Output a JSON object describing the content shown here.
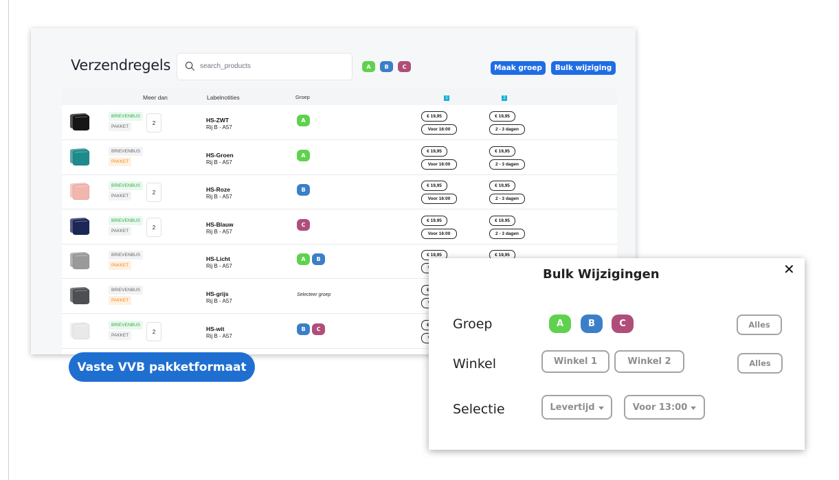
{
  "page": {
    "title": "Verzendregels"
  },
  "search": {
    "placeholder": "search_products"
  },
  "header_groups": [
    "A",
    "B",
    "C"
  ],
  "buttons": {
    "maak_groep": "Maak groep",
    "bulk_wijziging": "Bulk wijziging",
    "cta": "Vaste VVB pakketformaat"
  },
  "table": {
    "columns": {
      "meer_dan": "Meer dan",
      "labelnotities": "Labelnotities",
      "groep": "Groep",
      "shop1": "1",
      "shop2": "2"
    },
    "tag_labels": {
      "brievenbus": "BRIEVENBUS",
      "pakket": "PAKKET"
    },
    "rows": [
      {
        "name": "HS-ZWT",
        "location": "Rij B - A57",
        "active": "brievenbus",
        "qty": "2",
        "groups": [
          "A"
        ],
        "price1": "€ 19,95",
        "time1": "Voor 16:00",
        "price2": "€ 19,95",
        "time2": "2 - 3 dagen",
        "color": "#151515"
      },
      {
        "name": "HS-Groen",
        "location": "Rij B - A57",
        "active": "pakket",
        "qty": "",
        "groups": [
          "A"
        ],
        "price1": "€ 19,95",
        "time1": "Voor 16:00",
        "price2": "€ 19,95",
        "time2": "2 - 3 dagen",
        "color": "#1f8a8c"
      },
      {
        "name": "HS-Roze",
        "location": "Rij B - A57",
        "active": "brievenbus",
        "qty": "2",
        "groups": [
          "B"
        ],
        "price1": "€ 19,95",
        "time1": "Voor 16:00",
        "price2": "€ 19,95",
        "time2": "2 - 3 dagen",
        "color": "#f1b6ae"
      },
      {
        "name": "HS-Blauw",
        "location": "Rij B - A57",
        "active": "brievenbus",
        "qty": "2",
        "groups": [
          "C"
        ],
        "price1": "€ 19.95",
        "time1": "Voor 16:00",
        "price2": "€ 19.95",
        "time2": "2 - 3 dagen",
        "color": "#1c2757"
      },
      {
        "name": "HS-Licht",
        "location": "Rij B - A57",
        "active": "pakket",
        "qty": "",
        "groups": [
          "A",
          "B"
        ],
        "price1": "€ 19,95",
        "time1": "Voor 16:00",
        "price2": "€ 19,95",
        "time2": "",
        "color": "#9a9a9a"
      },
      {
        "name": "HS-grijs",
        "location": "Rij B - A57",
        "active": "pakket",
        "qty": "",
        "groups": [],
        "group_placeholder": "Selecteer groep",
        "price1": "€ 19,95",
        "time1": "Voor 16:00",
        "price2": "",
        "time2": "",
        "color": "#4d4f52"
      },
      {
        "name": "HS-wit",
        "location": "Rij B - A57",
        "active": "brievenbus",
        "qty": "2",
        "groups": [
          "B",
          "C"
        ],
        "price1": "€ 19,95",
        "time1": "Voor 16:00",
        "price2": "",
        "time2": "",
        "color": "#e9e9e9"
      }
    ]
  },
  "modal": {
    "title": "Bulk Wijzigingen",
    "close": "✕",
    "groep_label": "Groep",
    "groups": [
      "A",
      "B",
      "C"
    ],
    "alles": "Alles",
    "winkel_label": "Winkel",
    "winkels": [
      "Winkel 1",
      "Winkel 2"
    ],
    "selectie_label": "Selectie",
    "levertijd": "Levertijd",
    "tijd": "Voor 13:00"
  },
  "colors": {
    "A": "#5fd24d",
    "B": "#3b7fc8",
    "C": "#b04e7a",
    "primary": "#1f6de6"
  }
}
